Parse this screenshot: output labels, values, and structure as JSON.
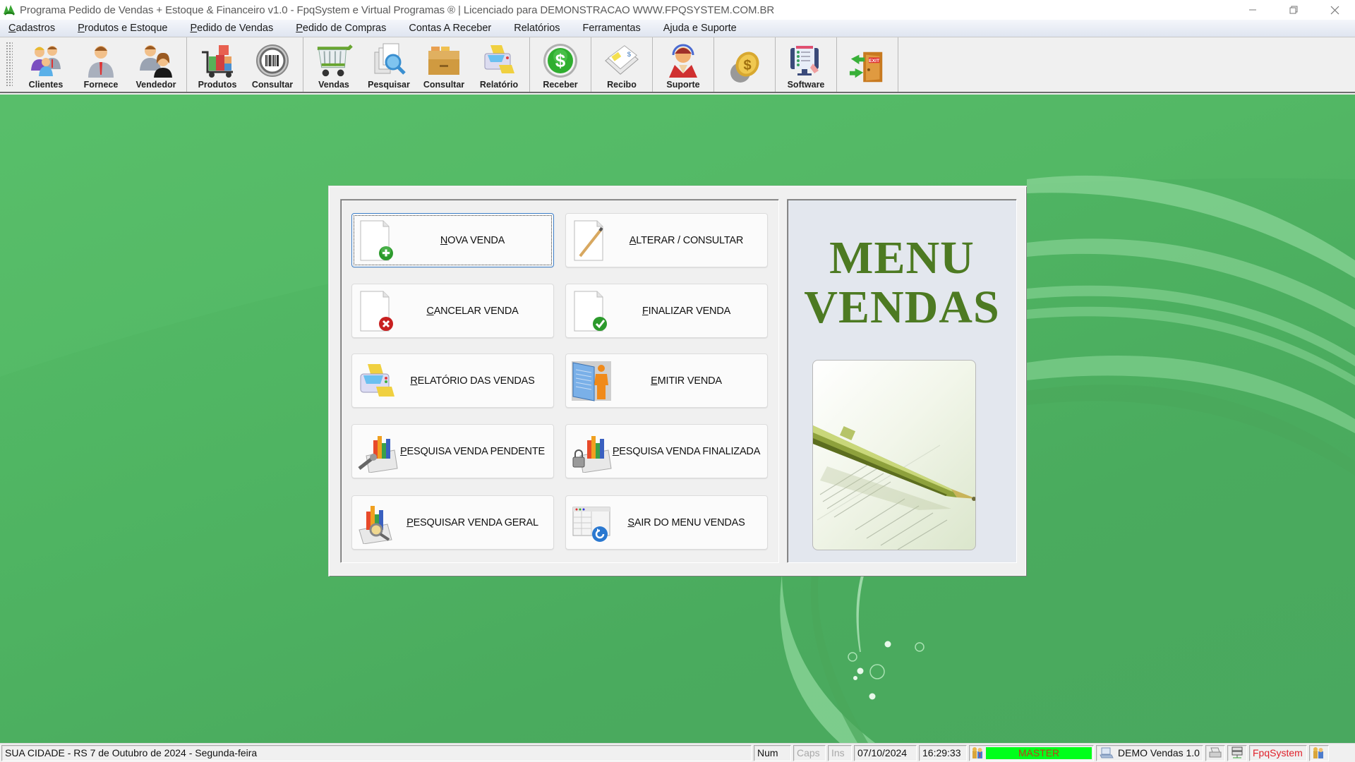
{
  "window": {
    "title": "Programa Pedido de Vendas + Estoque & Financeiro v1.0 - FpqSystem e Virtual Programas ® | Licenciado para  DEMONSTRACAO WWW.FPQSYSTEM.COM.BR",
    "controls": {
      "minimize": "minimize",
      "restore": "restore",
      "close": "close"
    }
  },
  "menubar": {
    "items": [
      {
        "label": "Cadastros",
        "accel": "C"
      },
      {
        "label": "Produtos e Estoque",
        "accel": "P"
      },
      {
        "label": "Pedido de Vendas",
        "accel": "P"
      },
      {
        "label": "Pedido de Compras",
        "accel": "P"
      },
      {
        "label": "Contas A Receber",
        "accel": ""
      },
      {
        "label": "Relatórios",
        "accel": ""
      },
      {
        "label": "Ferramentas",
        "accel": ""
      },
      {
        "label": "Ajuda e Suporte",
        "accel": ""
      }
    ]
  },
  "toolbar": {
    "groups": [
      [
        {
          "label": "Clientes",
          "icon": "clients-icon"
        },
        {
          "label": "Fornece",
          "icon": "supplier-icon"
        },
        {
          "label": "Vendedor",
          "icon": "seller-icon"
        }
      ],
      [
        {
          "label": "Produtos",
          "icon": "products-cart-icon"
        },
        {
          "label": "Consultar",
          "icon": "barcode-icon"
        }
      ],
      [
        {
          "label": "Vendas",
          "icon": "shopping-cart-icon"
        },
        {
          "label": "Pesquisar",
          "icon": "search-docs-icon"
        },
        {
          "label": "Consultar",
          "icon": "file-box-icon"
        },
        {
          "label": "Relatório",
          "icon": "printer-icon"
        }
      ],
      [
        {
          "label": "Receber",
          "icon": "dollar-coin-icon"
        }
      ],
      [
        {
          "label": "Recibo",
          "icon": "receipt-icon"
        }
      ],
      [
        {
          "label": "Suporte",
          "icon": "support-headset-icon"
        }
      ],
      [
        {
          "label": "",
          "icon": "gold-coin-icon"
        }
      ],
      [
        {
          "label": "Software",
          "icon": "software-monitor-icon"
        }
      ],
      [
        {
          "label": "",
          "icon": "exit-door-icon"
        }
      ]
    ]
  },
  "dialog": {
    "buttons": [
      {
        "label": "NOVA VENDA",
        "accel_index": 0,
        "icon": "new-document-icon",
        "focused": true
      },
      {
        "label": "ALTERAR / CONSULTAR",
        "accel_index": 0,
        "icon": "edit-pencil-icon",
        "focused": false
      },
      {
        "label": "CANCELAR VENDA",
        "accel_index": 0,
        "icon": "cancel-document-icon",
        "focused": false
      },
      {
        "label": "FINALIZAR VENDA",
        "accel_index": 0,
        "icon": "finalize-document-icon",
        "focused": false
      },
      {
        "label": "RELATÓRIO DAS VENDAS",
        "accel_index": 0,
        "icon": "printer-report-icon",
        "focused": false
      },
      {
        "label": "EMITIR VENDA",
        "accel_index": 0,
        "icon": "emit-document-person-icon",
        "focused": false
      },
      {
        "label": "PESQUISA VENDA PENDENTE",
        "accel_index": 0,
        "icon": "chart-search-icon",
        "focused": false
      },
      {
        "label": "PESQUISA VENDA FINALIZADA",
        "accel_index": 0,
        "icon": "chart-lock-icon",
        "focused": false
      },
      {
        "label": "PESQUISAR VENDA GERAL",
        "accel_index": 0,
        "icon": "chart-magnifier-icon",
        "focused": false
      },
      {
        "label": "SAIR DO MENU VENDAS",
        "accel_index": 0,
        "icon": "exit-window-icon",
        "focused": false
      }
    ],
    "side_title_line1": "MENU",
    "side_title_line2": "VENDAS",
    "side_image": "pen-on-document-image"
  },
  "statusbar": {
    "location_date": "SUA CIDADE - RS  7 de Outubro de 2024 - Segunda-feira",
    "num": "Num",
    "caps": "Caps",
    "ins": "Ins",
    "date": "07/10/2024",
    "time": "16:29:33",
    "user_level": "MASTER",
    "version": "DEMO Vendas 1.0",
    "brand": "FpqSystem"
  },
  "colors": {
    "background_green": "#4fb462",
    "title_green": "#4d7a22",
    "master_bg": "#00ff1a",
    "master_text": "#c0391b",
    "brand_red": "#e0202a"
  }
}
